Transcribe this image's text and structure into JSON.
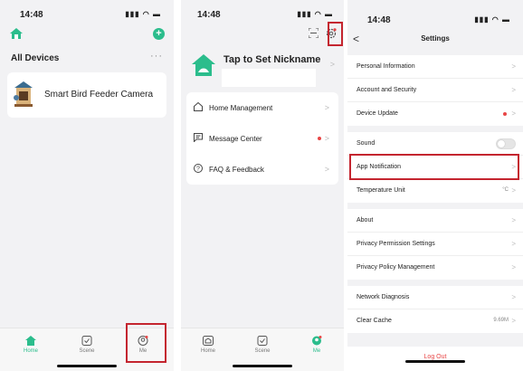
{
  "status": {
    "time": "14:48",
    "indicators": "▮▮▮ ◠ ▬"
  },
  "home_screen": {
    "add_icon": "plus-circle-icon",
    "section_title": "All Devices",
    "more_label": "···",
    "device": {
      "name": "Smart Bird Feeder Camera"
    },
    "tabs": [
      {
        "label": "Home",
        "icon": "home-icon"
      },
      {
        "label": "Scene",
        "icon": "scene-icon"
      },
      {
        "label": "Me",
        "icon": "me-icon"
      }
    ]
  },
  "me_screen": {
    "nickname_prompt": "Tap to Set Nickname",
    "menu": [
      {
        "label": "Home Management",
        "icon": "home-outline-icon"
      },
      {
        "label": "Message Center",
        "icon": "message-icon"
      },
      {
        "label": "FAQ & Feedback",
        "icon": "help-icon"
      }
    ],
    "tabs": [
      {
        "label": "Home"
      },
      {
        "label": "Scene"
      },
      {
        "label": "Me"
      }
    ]
  },
  "settings_screen": {
    "back_label": "<",
    "title": "Settings",
    "group1": [
      {
        "label": "Personal Information"
      },
      {
        "label": "Account and Security"
      },
      {
        "label": "Device Update"
      }
    ],
    "group2": [
      {
        "label": "Sound"
      },
      {
        "label": "App Notification"
      },
      {
        "label": "Temperature Unit",
        "value": "°C"
      }
    ],
    "group3": [
      {
        "label": "About"
      },
      {
        "label": "Privacy Permission Settings"
      },
      {
        "label": "Privacy Policy Management"
      }
    ],
    "group4": [
      {
        "label": "Network Diagnosis"
      },
      {
        "label": "Clear Cache",
        "value": "9.69M"
      }
    ],
    "logout_label": "Log Out"
  },
  "colors": {
    "accent": "#2bbd8c",
    "highlight": "#c4252f",
    "badge": "#e84646"
  }
}
